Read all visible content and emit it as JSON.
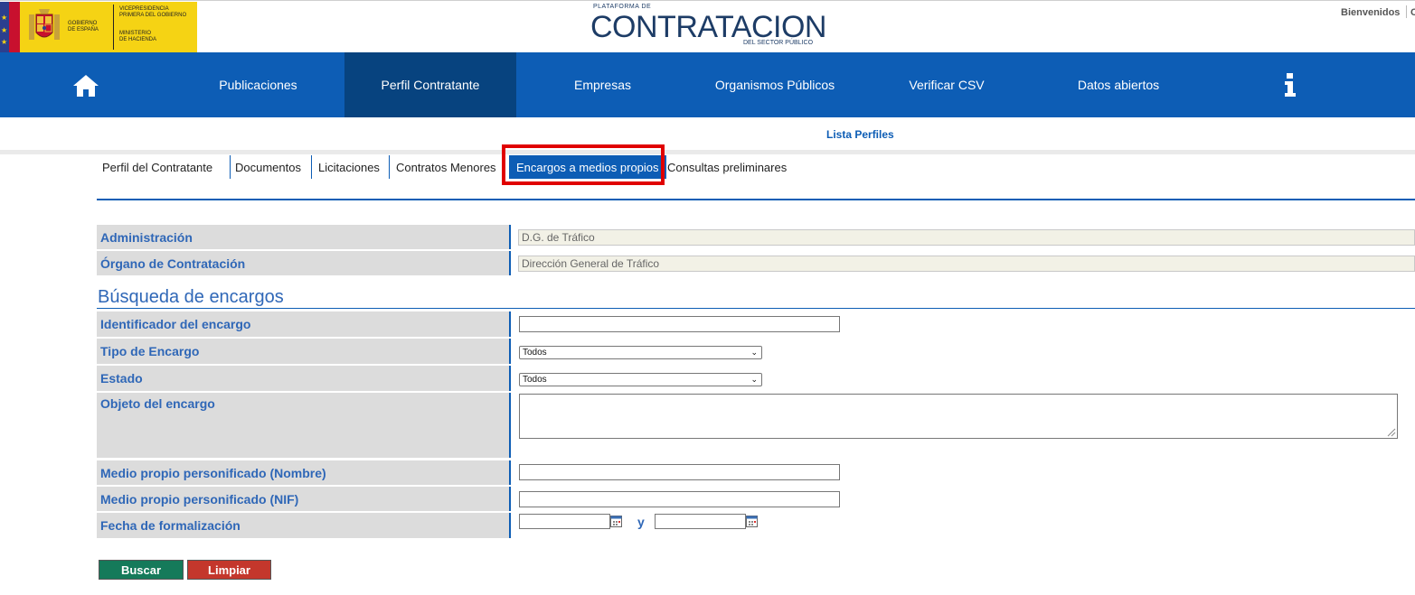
{
  "header": {
    "gov_line1": "GOBIERNO",
    "gov_line2": "DE ESPAÑA",
    "vice_line1": "VICEPRESIDENCIA",
    "vice_line2": "PRIMERA DEL GOBIERNO",
    "min_line1": "MINISTERIO",
    "min_line2": "DE HACIENDA",
    "brand_small": "PLATAFORMA DE",
    "brand_big": "CONTRATACION",
    "brand_sub": "DEL SECTOR PÚBLICO",
    "welcome": "Bienvenidos",
    "welcome_more": "C"
  },
  "nav": {
    "items": [
      {
        "label": "Publicaciones"
      },
      {
        "label": "Perfil Contratante"
      },
      {
        "label": "Empresas"
      },
      {
        "label": "Organismos Públicos"
      },
      {
        "label": "Verificar CSV"
      },
      {
        "label": "Datos abiertos"
      }
    ],
    "active_index": 1,
    "icons": [
      "home-icon",
      "info-icon"
    ],
    "active_color": "#07437f",
    "bar_color": "#0d5db5"
  },
  "sub": {
    "lista_perfiles": "Lista Perfiles"
  },
  "tabs": [
    {
      "label": "Perfil del Contratante"
    },
    {
      "label": "Documentos"
    },
    {
      "label": "Licitaciones"
    },
    {
      "label": "Contratos Menores"
    },
    {
      "label": "Encargos a medios propios"
    },
    {
      "label": "Consultas preliminares"
    }
  ],
  "tabs_active_index": 4,
  "info": {
    "administracion_label": "Administración",
    "administracion_value": "D.G. de Tráfico",
    "organo_label": "Órgano de Contratación",
    "organo_value": "Dirección General de Tráfico"
  },
  "search": {
    "title": "Búsqueda de encargos",
    "identificador_label": "Identificador del encargo",
    "identificador_value": "",
    "tipo_label": "Tipo de Encargo",
    "tipo_value": "Todos",
    "estado_label": "Estado",
    "estado_value": "Todos",
    "objeto_label": "Objeto del encargo",
    "objeto_value": "",
    "medio_nombre_label": "Medio propio personificado (Nombre)",
    "medio_nombre_value": "",
    "medio_nif_label": "Medio propio personificado (NIF)",
    "medio_nif_value": "",
    "fecha_label": "Fecha de formalización",
    "fecha_desde": "",
    "fecha_hasta": "",
    "fecha_sep": "y"
  },
  "buttons": {
    "buscar": "Buscar",
    "limpiar": "Limpiar",
    "buscar_color": "#157a5a",
    "limpiar_color": "#c4372c"
  },
  "highlight_color": "#e00000"
}
